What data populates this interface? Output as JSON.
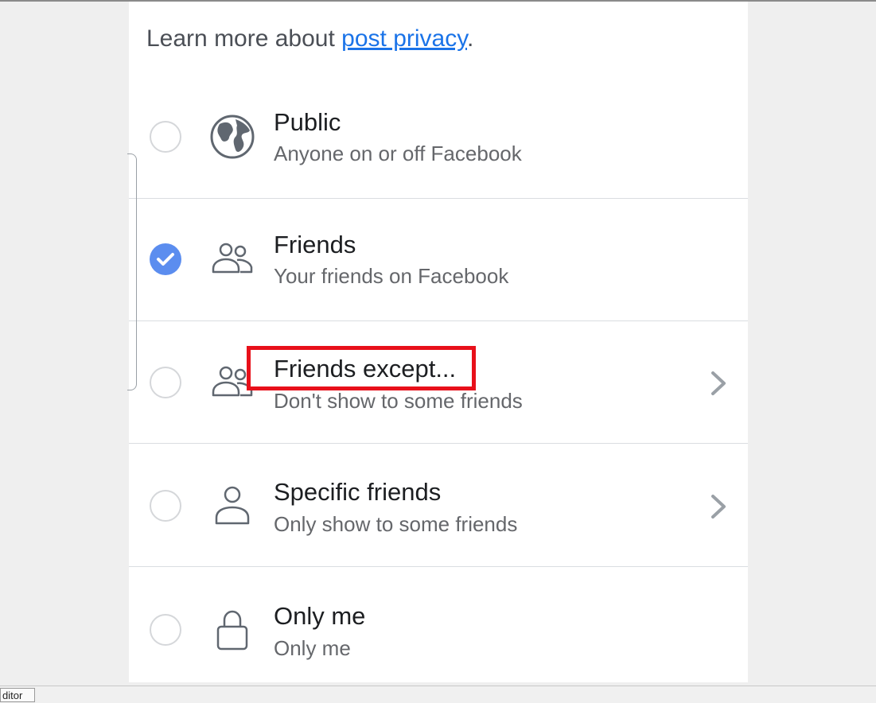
{
  "intro": {
    "text": "Learn more about ",
    "link": "post privacy",
    "suffix": "."
  },
  "options": [
    {
      "title": "Public",
      "subtitle": "Anyone on or off Facebook",
      "icon": "globe-icon",
      "selected": false,
      "has_chevron": false
    },
    {
      "title": "Friends",
      "subtitle": "Your friends on Facebook",
      "icon": "friends-icon",
      "selected": true,
      "has_chevron": false
    },
    {
      "title": "Friends except...",
      "subtitle": "Don't show to some friends",
      "icon": "friends-except-icon",
      "selected": false,
      "has_chevron": true
    },
    {
      "title": "Specific friends",
      "subtitle": "Only show to some friends",
      "icon": "person-icon",
      "selected": false,
      "has_chevron": true
    },
    {
      "title": "Only me",
      "subtitle": "Only me",
      "icon": "lock-icon",
      "selected": false,
      "has_chevron": false
    }
  ],
  "taskbar": {
    "tab_label": "ditor"
  },
  "colors": {
    "accent": "#5b8def",
    "link": "#1a73e8",
    "highlight": "#e8101a"
  }
}
